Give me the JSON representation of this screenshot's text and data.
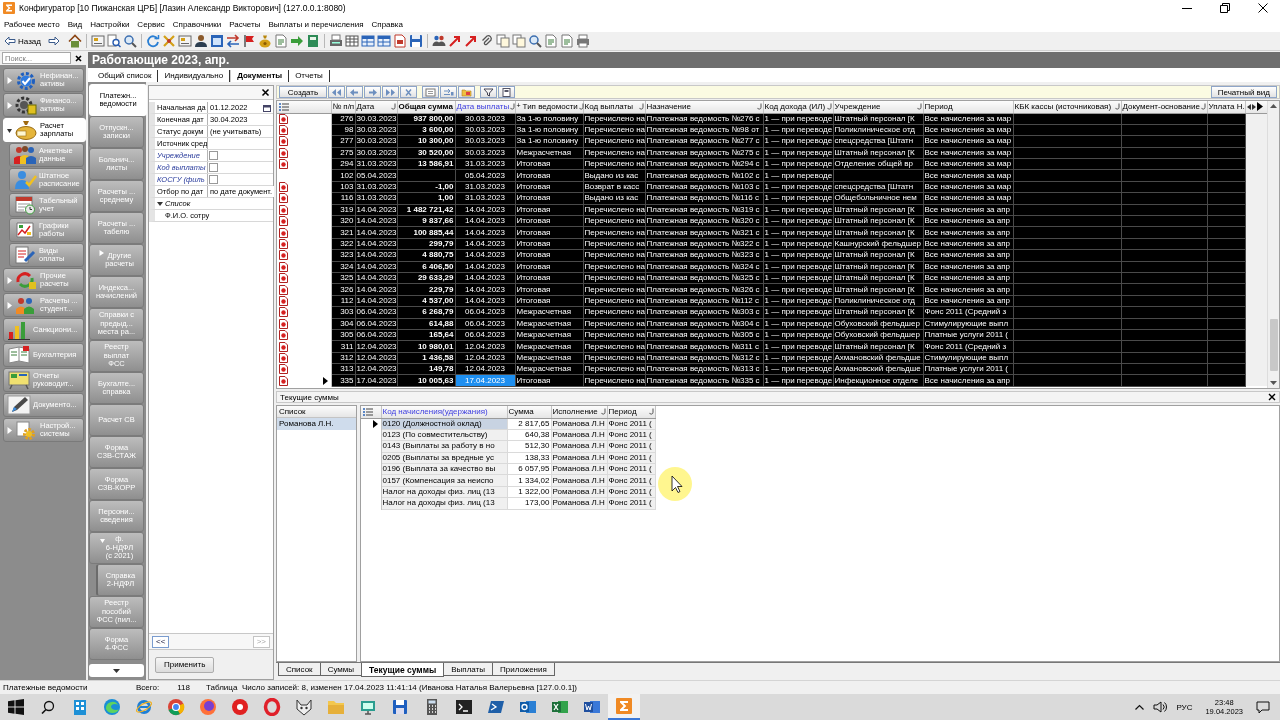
{
  "window": {
    "title": "Конфигуратор [10 Пижанская ЦРБ] [Лазин Александр Викторович] (127.0.0.1:8080)"
  },
  "menu": [
    "Рабочее место",
    "Вид",
    "Настройки",
    "Сервис",
    "Справочники",
    "Расчеты",
    "Выплаты и перечисления",
    "Справка"
  ],
  "toolbar": {
    "back": "Назад"
  },
  "sidebar": {
    "search": {
      "placeholder": "Поиск..."
    },
    "items": [
      {
        "label": "Нефинан...\nактивы",
        "expanded": false,
        "selected": false
      },
      {
        "label": "Финансо...\nактивы",
        "expanded": false,
        "selected": false
      },
      {
        "label": "Расчет\nзарплаты",
        "expanded": true,
        "selected": true,
        "children": [
          {
            "label": "Анкетные\nданные",
            "selected": false
          },
          {
            "label": "Штатное\nрасписание",
            "selected": false
          },
          {
            "label": "Табельный\nучет",
            "selected": false
          },
          {
            "label": "Графики\nработы",
            "selected": false
          },
          {
            "label": "Виды\nоплаты",
            "selected": false
          }
        ]
      },
      {
        "label": "Прочие\nрасчеты",
        "expanded": false,
        "selected": false
      },
      {
        "label": "Расчеты ...\nстудент...",
        "expanded": false,
        "selected": false
      },
      {
        "label": "Санкциони...",
        "selected": false
      },
      {
        "label": "Бухгалтерия",
        "selected": false
      },
      {
        "label": "Отчеты\nруководит...",
        "selected": false
      },
      {
        "label": "Документо...",
        "selected": false
      },
      {
        "label": "Настрой...\nсистемы",
        "expanded": false,
        "selected": false
      }
    ]
  },
  "document": {
    "title": "Работающие 2023, апр."
  },
  "tabs": [
    {
      "label": "Общий список",
      "selected": false
    },
    {
      "label": "Индивидуально",
      "selected": false
    },
    {
      "label": "Документы",
      "selected": true
    },
    {
      "label": "Отчеты",
      "selected": false
    }
  ],
  "doc_types": [
    {
      "label": "Платежн...\nведомости",
      "selected": true
    },
    {
      "label": "Отпускн...\nзаписки",
      "selected": false
    },
    {
      "label": "Больнич...\nлисты",
      "selected": false
    },
    {
      "label": "Расчеты ...\nсреднему",
      "selected": false
    },
    {
      "label": "Расчеты ...\nтабелю",
      "selected": false
    },
    {
      "label": "Другие\nрасчеты",
      "expanded": false,
      "selected": false
    },
    {
      "label": "Индекса...\nначислений",
      "selected": false
    },
    {
      "label": "Справки с\nпредыд...\nместа ра...",
      "selected": false
    },
    {
      "label": "Реестр\nвыплат\nФСС",
      "selected": false
    },
    {
      "label": "Бухгалте...\nсправка",
      "selected": false
    },
    {
      "label": "Расчет СВ",
      "selected": false
    },
    {
      "label": "Форма\nСЗВ-СТАЖ",
      "selected": false
    },
    {
      "label": "Форма\nСЗВ-КОРР",
      "selected": false
    },
    {
      "label": "Персони...\nсведения",
      "selected": false
    },
    {
      "label": "ф.\n6-НДФЛ\n(с 2021)",
      "expanded": true,
      "selected": false,
      "children": [
        {
          "label": "Справка\n2-НДФЛ",
          "selected": false
        }
      ]
    },
    {
      "label": "Реестр\nпособий\nФСС (пил...",
      "selected": false
    },
    {
      "label": "Форма\n4-ФСС",
      "selected": false
    }
  ],
  "filter": {
    "rows": [
      {
        "label": "Начальная да",
        "kind": "date",
        "value": "01.12.2022"
      },
      {
        "label": "Конечная дат",
        "kind": "text",
        "value": "30.04.2023"
      },
      {
        "label": "Статус докум",
        "kind": "text",
        "value": "(не учитывать)"
      },
      {
        "label": "Источник сред",
        "kind": "text"
      },
      {
        "label": "Учреждение",
        "kind": "check",
        "checked": false
      },
      {
        "label": "Код выплаты",
        "kind": "check",
        "checked": false
      },
      {
        "label": "КОСГУ (филь",
        "kind": "check",
        "checked": false
      },
      {
        "label": "Отбор по дат",
        "kind": "text",
        "value": "по дате документ."
      },
      {
        "label": "Список",
        "kind": "group",
        "expanded": true,
        "children": [
          {
            "label": "Ф.И.О. сотру",
            "kind": "text"
          }
        ]
      }
    ],
    "pager": [
      {
        "label": "<<",
        "disabled": false
      },
      {
        "label": ">>",
        "disabled": true
      }
    ],
    "apply": "Применить"
  },
  "grid_toolbar": {
    "create": "Создать",
    "print": "Печатный вид"
  },
  "grid": {
    "columns": [
      {
        "label": "№ п/п",
        "corner_mark": false,
        "selected": false
      },
      {
        "label": "Дата",
        "corner_mark": true,
        "selected": false
      },
      {
        "label": "Общая сумма",
        "corner_mark": false,
        "selected": false
      },
      {
        "label": "Дата выплаты",
        "corner_mark": true,
        "selected": true
      },
      {
        "label": "Тип ведомости",
        "prefix": "+",
        "corner_mark": true,
        "selected": false
      },
      {
        "label": "Код выплаты",
        "corner_mark": true,
        "selected": false
      },
      {
        "label": "Назначение",
        "corner_mark": true,
        "selected": false
      },
      {
        "label": "Код дохода (ИЛ)",
        "corner_mark": true,
        "selected": false
      },
      {
        "label": "Учреждение",
        "corner_mark": true,
        "selected": false
      },
      {
        "label": "Период",
        "corner_mark": false,
        "selected": false
      },
      {
        "label": "КБК кассы (источниковая)",
        "corner_mark": true,
        "selected": false
      },
      {
        "label": "Документ-основание",
        "corner_mark": true,
        "selected": false
      },
      {
        "label": "Уплата Н.",
        "corner_mark": false,
        "selected": false
      }
    ],
    "rows": [
      {
        "selected": false,
        "attachment": true,
        "cells": [
          "276",
          "30.03.2023",
          "937 800,00",
          "30.03.2023",
          "За 1-ю половину",
          "Перечислено на",
          "Платежная ведомость №276 с",
          "1 — при переводе",
          "Штатный персонал [К",
          "Все начисления за мар"
        ]
      },
      {
        "selected": false,
        "attachment": true,
        "cells": [
          "98",
          "30.03.2023",
          "3 600,00",
          "30.03.2023",
          "За 1-ю половину",
          "Перечислено на",
          "Платежная ведомость №98 от",
          "1 — при переводе",
          "Поликлиническое отд",
          "Все начисления за мар"
        ]
      },
      {
        "selected": false,
        "attachment": true,
        "cells": [
          "277",
          "30.03.2023",
          "10 300,00",
          "30.03.2023",
          "За 1-ю половину",
          "Перечислено на",
          "Платежная ведомость №277 с",
          "1 — при переводе",
          "спецсредства [Штатн",
          "Все начисления за мар"
        ]
      },
      {
        "selected": false,
        "attachment": true,
        "cells": [
          "275",
          "30.03.2023",
          "30 520,00",
          "30.03.2023",
          "Межрасчетная",
          "Перечислено на",
          "Платежная ведомость №275 с",
          "1 — при переводе",
          "Штатный персонал [К",
          "Все начисления за мар"
        ]
      },
      {
        "selected": false,
        "attachment": true,
        "cells": [
          "294",
          "31.03.2023",
          "13 586,91",
          "31.03.2023",
          "Итоговая",
          "Перечислено на",
          "Платежная ведомость №294 с",
          "1 — при переводе",
          "Отделение общей вр",
          "Все начисления за мар"
        ]
      },
      {
        "selected": false,
        "attachment": false,
        "cells": [
          "102",
          "05.04.2023",
          null,
          "05.04.2023",
          "Итоговая",
          "Выдано из кас",
          "Платежная ведомость №102 с",
          "1 — при переводе",
          null,
          "Все начисления за мар"
        ]
      },
      {
        "selected": false,
        "attachment": true,
        "cells": [
          "103",
          "31.03.2023",
          "-1,00",
          "31.03.2023",
          "Итоговая",
          "Возврат в касс",
          "Платежная ведомость №103 с",
          "1 — при переводе",
          "спецсредства [Штатн",
          "Все начисления за мар"
        ]
      },
      {
        "selected": false,
        "attachment": true,
        "cells": [
          "116",
          "31.03.2023",
          "1,00",
          "31.03.2023",
          "Итоговая",
          "Выдано из кас",
          "Платежная ведомость №116 с",
          "1 — при переводе",
          "Общебольничное нем",
          "Все начисления за мар"
        ]
      },
      {
        "selected": false,
        "attachment": true,
        "cells": [
          "319",
          "14.04.2023",
          "1 482 721,42",
          "14.04.2023",
          "Итоговая",
          "Перечислено на",
          "Платежная ведомость №319 с",
          "1 — при переводе",
          "Штатный персонал [К",
          "Все начисления за апр"
        ]
      },
      {
        "selected": false,
        "attachment": true,
        "cells": [
          "320",
          "14.04.2023",
          "9 837,66",
          "14.04.2023",
          "Итоговая",
          "Перечислено на",
          "Платежная ведомость №320 с",
          "1 — при переводе",
          "Штатный персонал [К",
          "Все начисления за апр"
        ]
      },
      {
        "selected": false,
        "attachment": true,
        "cells": [
          "321",
          "14.04.2023",
          "100 885,44",
          "14.04.2023",
          "Итоговая",
          "Перечислено на",
          "Платежная ведомость №321 с",
          "1 — при переводе",
          "Штатный персонал [К",
          "Все начисления за апр"
        ]
      },
      {
        "selected": false,
        "attachment": true,
        "cells": [
          "322",
          "14.04.2023",
          "299,79",
          "14.04.2023",
          "Итоговая",
          "Перечислено на",
          "Платежная ведомость №322 с",
          "1 — при переводе",
          "Кашнурский фельдшер",
          "Все начисления за апр"
        ]
      },
      {
        "selected": false,
        "attachment": true,
        "cells": [
          "323",
          "14.04.2023",
          "4 880,75",
          "14.04.2023",
          "Итоговая",
          "Перечислено на",
          "Платежная ведомость №323 с",
          "1 — при переводе",
          "Штатный персонал [К",
          "Все начисления за апр"
        ]
      },
      {
        "selected": false,
        "attachment": true,
        "cells": [
          "324",
          "14.04.2023",
          "6 406,50",
          "14.04.2023",
          "Итоговая",
          "Перечислено на",
          "Платежная ведомость №324 с",
          "1 — при переводе",
          "Штатный персонал [К",
          "Все начисления за апр"
        ]
      },
      {
        "selected": false,
        "attachment": true,
        "cells": [
          "325",
          "14.04.2023",
          "29 633,29",
          "14.04.2023",
          "Итоговая",
          "Перечислено на",
          "Платежная ведомость №325 с",
          "1 — при переводе",
          "Штатный персонал [К",
          "Все начисления за апр"
        ]
      },
      {
        "selected": false,
        "attachment": true,
        "cells": [
          "326",
          "14.04.2023",
          "229,79",
          "14.04.2023",
          "Итоговая",
          "Перечислено на",
          "Платежная ведомость №326 с",
          "1 — при переводе",
          "Штатный персонал [К",
          "Все начисления за апр"
        ]
      },
      {
        "selected": false,
        "attachment": true,
        "cells": [
          "112",
          "14.04.2023",
          "4 537,00",
          "14.04.2023",
          "Итоговая",
          "Перечислено на",
          "Платежная ведомость №112 с",
          "1 — при переводе",
          "Поликлиническое отд",
          "Все начисления за апр"
        ]
      },
      {
        "selected": false,
        "attachment": true,
        "cells": [
          "303",
          "06.04.2023",
          "6 268,79",
          "06.04.2023",
          "Межрасчетная",
          "Перечислено на",
          "Платежная ведомость №303 с",
          "1 — при переводе",
          "Штатный персонал [К",
          "Фонс 2011 (Средний з"
        ]
      },
      {
        "selected": false,
        "attachment": true,
        "cells": [
          "304",
          "06.04.2023",
          "614,88",
          "06.04.2023",
          "Межрасчетная",
          "Перечислено на",
          "Платежная ведомость №304 с",
          "1 — при переводе",
          "Обуховский фельдшер",
          "Стимулирующие выпл"
        ]
      },
      {
        "selected": false,
        "attachment": true,
        "cells": [
          "305",
          "06.04.2023",
          "165,64",
          "06.04.2023",
          "Межрасчетная",
          "Перечислено на",
          "Платежная ведомость №305 с",
          "1 — при переводе",
          "Обуховский фельдшер",
          "Платные услуги 2011 ("
        ]
      },
      {
        "selected": false,
        "attachment": true,
        "cells": [
          "311",
          "12.04.2023",
          "10 980,01",
          "12.04.2023",
          "Межрасчетная",
          "Перечислено на",
          "Платежная ведомость №311 с",
          "1 — при переводе",
          "Штатный персонал [К",
          "Фонс 2011 (Средний з"
        ]
      },
      {
        "selected": false,
        "attachment": true,
        "cells": [
          "312",
          "12.04.2023",
          "1 436,58",
          "12.04.2023",
          "Межрасчетная",
          "Перечислено на",
          "Платежная ведомость №312 с",
          "1 — при переводе",
          "Ахмановский фельдше",
          "Стимулирующие выпл"
        ]
      },
      {
        "selected": false,
        "attachment": true,
        "cells": [
          "313",
          "12.04.2023",
          "149,78",
          "12.04.2023",
          "Межрасчетная",
          "Перечислено на",
          "Платежная ведомость №313 с",
          "1 — при переводе",
          "Ахмановский фельдше",
          "Платные услуги 2011 ("
        ]
      },
      {
        "selected": true,
        "attachment": true,
        "cells": [
          "335",
          "17.04.2023",
          "10 005,63",
          "17.04.2023",
          "Итоговая",
          "Перечислено на",
          "Платежная ведомость №335 с",
          "1 — при переводе",
          "Инфекционное отделе",
          "Все начисления за апр"
        ]
      }
    ]
  },
  "current_sums": {
    "title": "Текущие суммы",
    "list": {
      "header": "Список",
      "items": [
        {
          "label": "Романова Л.Н.",
          "selected": true
        }
      ]
    },
    "columns": [
      {
        "label": "Код начисления(удержания)",
        "corner_mark": false,
        "selected": true
      },
      {
        "label": "Сумма",
        "corner_mark": false,
        "selected": false
      },
      {
        "label": "Исполнение",
        "corner_mark": true,
        "selected": false
      },
      {
        "label": "Период",
        "corner_mark": true,
        "selected": false
      }
    ],
    "rows": [
      {
        "selected": true,
        "cells": [
          "0120 (Должностной оклад)",
          "2 817,65",
          "Романова Л.Н",
          "Фонс 2011 ("
        ]
      },
      {
        "selected": false,
        "cells": [
          "0123 (По совместительству)",
          "640,38",
          "Романова Л.Н",
          "Фонс 2011 ("
        ]
      },
      {
        "selected": false,
        "cells": [
          "0143 (Выплаты за работу в но",
          "512,30",
          "Романова Л.Н",
          "Фонс 2011 ("
        ]
      },
      {
        "selected": false,
        "cells": [
          "0205 (Выплаты за вредные ус",
          "138,33",
          "Романова Л.Н",
          "Фонс 2011 ("
        ]
      },
      {
        "selected": false,
        "cells": [
          "0196 (Выплата за качество вы",
          "6 057,95",
          "Романова Л.Н",
          "Фонс 2011 ("
        ]
      },
      {
        "selected": false,
        "cells": [
          "0157 (Компенсация за неиспо",
          "1 334,02",
          "Романова Л.Н",
          "Фонс 2011 ("
        ]
      },
      {
        "selected": false,
        "cells": [
          "Налог на доходы физ. лиц (13",
          "1 322,00",
          "Романова Л.Н",
          "Фонс 2011 ("
        ]
      },
      {
        "selected": false,
        "cells": [
          "Налог на доходы физ. лиц (13",
          "173,00",
          "Романова Л.Н",
          "Фонс 2011 ("
        ]
      }
    ]
  },
  "bottom_tabs": [
    {
      "label": "Список",
      "selected": false
    },
    {
      "label": "Суммы",
      "selected": false
    },
    {
      "label": "Текущие суммы",
      "selected": true
    },
    {
      "label": "Выплаты",
      "selected": false
    },
    {
      "label": "Приложения",
      "selected": false
    }
  ],
  "status_bar": [
    "Платежные ведомости",
    "Всего:",
    "118",
    "Таблица",
    "Число записей: 8, изменен 17.04.2023 11:41:14 (Иванова Наталья Валерьевна [127.0.0.1])"
  ],
  "taskbar": {
    "apps": [
      {
        "selected": false
      },
      {
        "selected": false
      },
      {
        "selected": false
      },
      {
        "selected": false
      },
      {
        "selected": false
      },
      {
        "selected": false
      },
      {
        "selected": false
      },
      {
        "selected": false
      },
      {
        "selected": false
      },
      {
        "selected": false
      },
      {
        "selected": false
      },
      {
        "selected": false
      },
      {
        "selected": false
      },
      {
        "selected": false
      },
      {
        "selected": false
      },
      {
        "selected": false
      },
      {
        "selected": false
      },
      {
        "selected": true
      }
    ],
    "language": "РУС",
    "time": "23:48",
    "date": "19.04.2023"
  }
}
